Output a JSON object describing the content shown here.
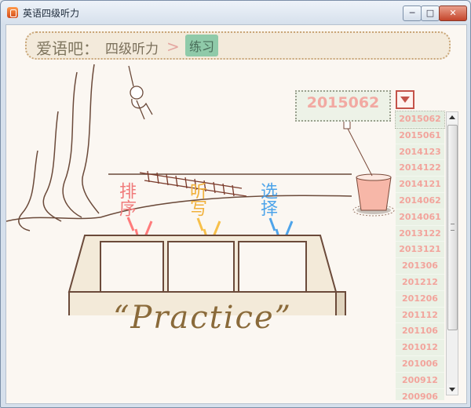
{
  "window": {
    "title": "英语四级听力",
    "min_glyph": "─",
    "max_glyph": "□",
    "close_glyph": "✕"
  },
  "breadcrumb": {
    "site": "爱语吧：",
    "section": "四级听力",
    "sep": ">",
    "current": "练习"
  },
  "categories": {
    "sort": "排序",
    "dictation": "听写",
    "choice": "选择"
  },
  "practice_label": "“Practice”",
  "year_selector": {
    "value": "2015062"
  },
  "year_list": [
    "2015062",
    "2015061",
    "2014123",
    "2014122",
    "2014121",
    "2014062",
    "2014061",
    "2013122",
    "2013121",
    "201306",
    "201212",
    "201206",
    "201112",
    "201106",
    "201012",
    "201006",
    "200912",
    "200906"
  ],
  "colors": {
    "sort": "#f07a7a",
    "dictation": "#f1b13c",
    "choice": "#4ea4ea",
    "year_text": "#f2a9a2"
  }
}
